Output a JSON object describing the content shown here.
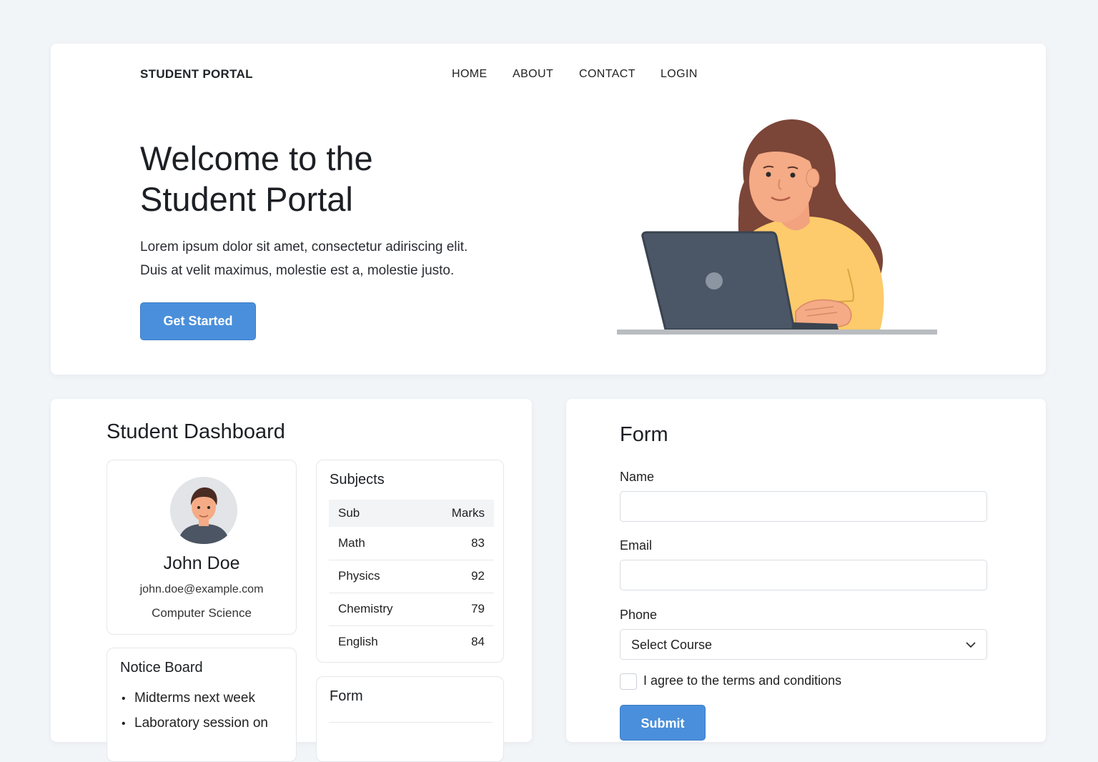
{
  "header": {
    "brand": "STUDENT PORTAL",
    "nav": [
      "HOME",
      "ABOUT",
      "CONTACT",
      "LOGIN"
    ]
  },
  "hero": {
    "title_line1": "Welcome to the",
    "title_line2": "Student Portal",
    "text_line1": "Lorem ipsum dolor sit amet, consectetur adiriscing elit.",
    "text_line2": "Duis at velit maximus, molestie est a, molestie justo.",
    "cta": "Get Started"
  },
  "dashboard": {
    "title": "Student Dashboard",
    "profile": {
      "name": "John Doe",
      "email": "john.doe@example.com",
      "department": "Computer Science"
    },
    "notice_board": {
      "title": "Notice Board",
      "items": [
        "Midterms next week",
        "Laboratory session on"
      ]
    },
    "subjects": {
      "title": "Subjects",
      "headers": [
        "Sub",
        "Marks"
      ],
      "rows": [
        {
          "subject": "Math",
          "marks": "83"
        },
        {
          "subject": "Physics",
          "marks": "92"
        },
        {
          "subject": "Chemistry",
          "marks": "79"
        },
        {
          "subject": "English",
          "marks": "84"
        }
      ]
    },
    "mini_form": {
      "title": "Form"
    }
  },
  "form": {
    "title": "Form",
    "name_label": "Name",
    "email_label": "Email",
    "phone_label": "Phone",
    "select_value": "Select Course",
    "checkbox_label": "I agree to the terms and conditions",
    "submit": "Submit"
  },
  "colors": {
    "accent": "#4a8fdb",
    "background": "#f2f5f8",
    "illustration_sweater": "#fdcb6b",
    "illustration_hair": "#7b4538",
    "illustration_laptop": "#4b5766"
  },
  "icons": [
    "chevron-down-icon",
    "avatar-icon",
    "student-illustration"
  ]
}
